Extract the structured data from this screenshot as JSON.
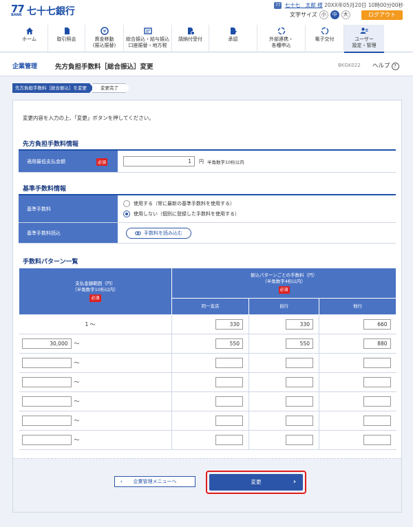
{
  "header": {
    "logo_mark": "77",
    "logo_sub": "BANK",
    "bank_name": "七十七銀行",
    "user_icon": "77",
    "user_name": "七十七　太郎 様",
    "datetime": "20XX年05月20日 10時00分00秒",
    "font_size_label": "文字サイズ",
    "font_sizes": [
      "小",
      "中",
      "大"
    ],
    "font_size_selected": "中",
    "logout_label": "ログアウト"
  },
  "nav": [
    {
      "icon": "home-icon",
      "label": "ホーム"
    },
    {
      "icon": "document-icon",
      "label": "取引照会"
    },
    {
      "icon": "transfer-icon",
      "label": "資金移動\n(振込振替)"
    },
    {
      "icon": "bulk-transfer-icon",
      "label": "総合振込・給与振込\n口座振替・地方税"
    },
    {
      "icon": "request-icon",
      "label": "請納付受付"
    },
    {
      "icon": "approval-icon",
      "label": "承認"
    },
    {
      "icon": "link-icon",
      "label": "外部連携・\n各種申込"
    },
    {
      "icon": "e-delivery-icon",
      "label": "電子交付"
    },
    {
      "icon": "user-settings-icon",
      "label": "ユーザー\n設定・管理"
    }
  ],
  "page": {
    "breadcrumb": "企業管理",
    "title": "先方負担手数料［総合振込］変更",
    "code": "BKGK022",
    "help": "ヘルプ"
  },
  "steps": [
    "先方負担手数料［総合振込］を変更",
    "変更完了"
  ],
  "intro": "変更内容を入力の上、「変更」ボタンを押してください。",
  "required_label": "必須",
  "section1": {
    "title": "先方負担手数料情報",
    "field_label": "適用最低支払金額",
    "value": "1",
    "unit": "円",
    "hint": "半角数字10桁以内"
  },
  "section2": {
    "title": "基準手数料情報",
    "fee_label": "基準手数料",
    "option_use": "使用する（常に最新の基準手数料を使用する）",
    "option_nouse": "使用しない（個別に登録した手数料を使用する）",
    "selected": "nouse",
    "load_label": "基準手数料読込",
    "load_button": "手数料を読み込む"
  },
  "section3": {
    "title": "手数料パターン一覧",
    "col_range": "支払金額範囲（円）",
    "col_range_hint": "（半角数字10桁以内）",
    "col_fee": "振込パターンごとの手数料（円）",
    "col_fee_hint": "（半角数字4桁以内）",
    "col_same_branch": "同一支店",
    "col_own_bank": "自行",
    "col_other_bank": "他行",
    "tilde": "～",
    "rows": [
      {
        "min": "1",
        "same": "330",
        "own": "330",
        "other": "660"
      },
      {
        "min": "30,000",
        "same": "550",
        "own": "550",
        "other": "880"
      },
      {
        "min": "",
        "same": "",
        "own": "",
        "other": ""
      },
      {
        "min": "",
        "same": "",
        "own": "",
        "other": ""
      },
      {
        "min": "",
        "same": "",
        "own": "",
        "other": ""
      },
      {
        "min": "",
        "same": "",
        "own": "",
        "other": ""
      },
      {
        "min": "",
        "same": "",
        "own": "",
        "other": ""
      }
    ]
  },
  "actions": {
    "back": "企業管理メニューへ",
    "submit": "変更"
  }
}
